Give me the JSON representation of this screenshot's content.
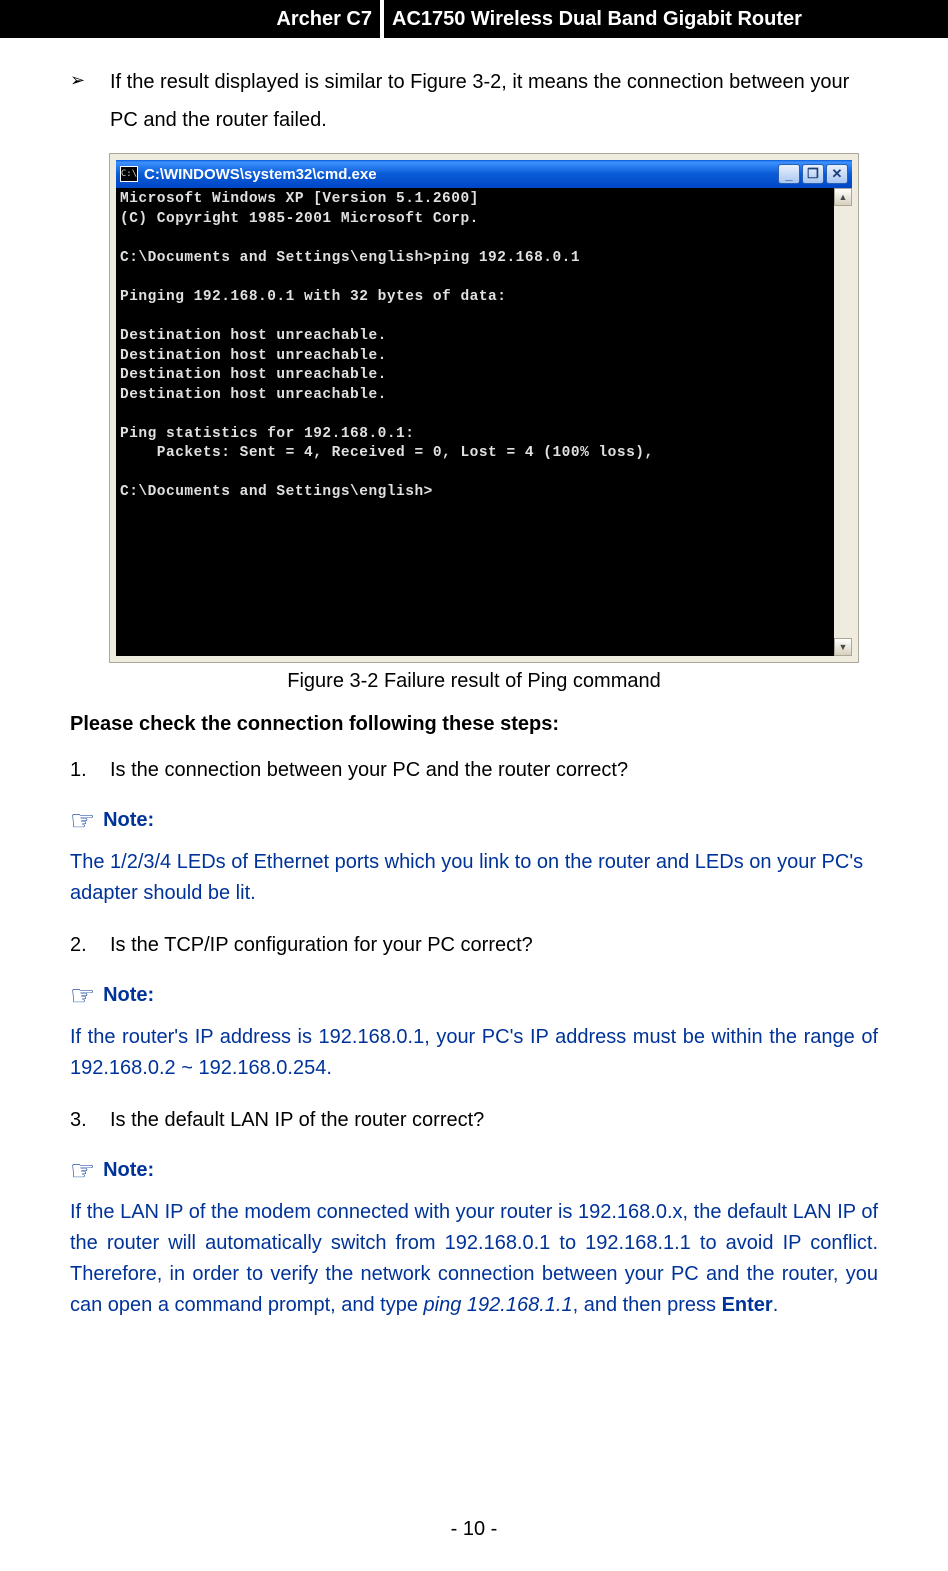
{
  "header": {
    "model": "Archer C7",
    "product": "AC1750 Wireless Dual Band Gigabit Router"
  },
  "intro_bullet": "If the result displayed is similar to Figure 3-2, it means the connection between your PC and the router failed.",
  "cmd_window": {
    "icon_text": "C:\\",
    "title": "C:\\WINDOWS\\system32\\cmd.exe",
    "buttons": {
      "minimize": "_",
      "restore": "❐",
      "close": "✕"
    },
    "lines": [
      "Microsoft Windows XP [Version 5.1.2600]",
      "(C) Copyright 1985-2001 Microsoft Corp.",
      "",
      "C:\\Documents and Settings\\english>ping 192.168.0.1",
      "",
      "Pinging 192.168.0.1 with 32 bytes of data:",
      "",
      "Destination host unreachable.",
      "Destination host unreachable.",
      "Destination host unreachable.",
      "Destination host unreachable.",
      "",
      "Ping statistics for 192.168.0.1:",
      "    Packets: Sent = 4, Received = 0, Lost = 4 (100% loss),",
      "",
      "C:\\Documents and Settings\\english>"
    ]
  },
  "figure_caption": "Figure 3-2 Failure result of Ping command",
  "check_heading": "Please check the connection following these steps:",
  "steps": [
    {
      "num": "1.",
      "text": "Is the connection between your PC and the router correct?"
    },
    {
      "num": "2.",
      "text": "Is the TCP/IP configuration for your PC correct?"
    },
    {
      "num": "3.",
      "text": "Is the default LAN IP of the router correct?"
    }
  ],
  "notes": {
    "label": "Note:",
    "note1": "The 1/2/3/4 LEDs of Ethernet ports which you link to on the router and LEDs on your PC's adapter should be lit.",
    "note2": "If the router's IP address is 192.168.0.1, your PC's IP address must be within the range of 192.168.0.2 ~ 192.168.0.254.",
    "note3_pre": "If the LAN IP of the modem connected with your router is 192.168.0.x, the default LAN IP of the router will automatically switch from 192.168.0.1 to 192.168.1.1 to avoid IP conflict. Therefore, in order to verify the network connection between your PC and the router, you can open a command prompt, and type ",
    "note3_ping": "ping 192.168.1.1",
    "note3_mid": ", and then press ",
    "note3_enter": "Enter",
    "note3_end": "."
  },
  "footer": "- 10 -"
}
